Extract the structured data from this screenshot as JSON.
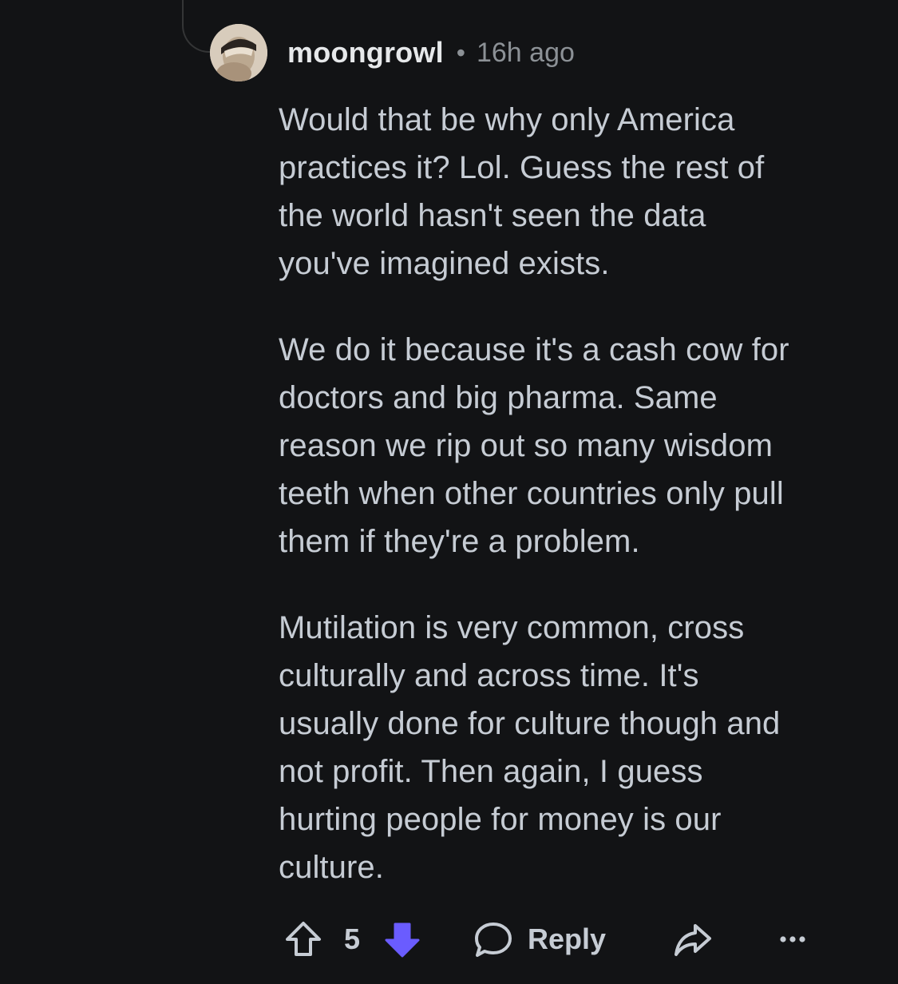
{
  "comment": {
    "username": "moongrowl",
    "separator": "•",
    "timestamp": "16h ago",
    "avatar_icon": "user-avatar",
    "paragraphs": [
      "Would that be why only America\npractices it? Lol. Guess the rest of\nthe world hasn't seen the data\nyou've imagined exists.",
      "We do it because it's a cash cow for\ndoctors and big pharma. Same\nreason we rip out so many wisdom\nteeth when other countries only pull\nthem if they're a problem.",
      "Mutilation is very common, cross\nculturally and across time. It's\nusually done for culture though and\nnot profit. Then again, I guess\nhurting people for money is our\nculture."
    ]
  },
  "actions": {
    "upvote_icon": "upvote-arrow-icon",
    "vote_count": "5",
    "downvote_icon": "downvote-arrow-icon",
    "downvote_state": "active",
    "downvote_color": "#6a5cff",
    "reply_icon": "speech-bubble-icon",
    "reply_label": "Reply",
    "share_icon": "share-arrow-icon",
    "more_icon": "more-dots-icon"
  },
  "colors": {
    "background": "#121315",
    "text": "#c6ccd4",
    "muted": "#8c9196"
  }
}
